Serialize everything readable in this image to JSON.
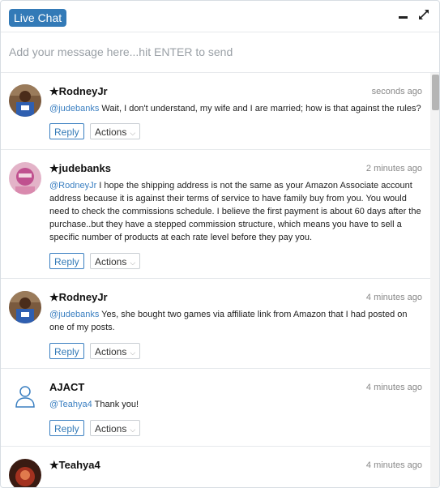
{
  "header": {
    "title": "Live Chat",
    "minimize_icon": "minimize-icon",
    "expand_icon": "expand-icon"
  },
  "composer": {
    "placeholder": "Add your message here...hit ENTER to send"
  },
  "messages": [
    {
      "author": "★RodneyJr",
      "time": "seconds ago",
      "mention": "@judebanks",
      "text": " Wait, I don't understand, my wife and I are married; how is that against the rules?",
      "reply_label": "Reply",
      "actions_label": "Actions",
      "avatar": "photo-avatar"
    },
    {
      "author": "★judebanks",
      "time": "2 minutes ago",
      "mention": "@RodneyJr",
      "text": " I hope the shipping address is not the same as your Amazon Associate account address because it is against their terms of service to have family buy from you. You would need to check the commissions schedule. I believe the first payment is about 60 days after the purchase..but they have a stepped commission structure, which means you have to sell a specific number of products at each rate level before they pay you.",
      "reply_label": "Reply",
      "actions_label": "Actions",
      "avatar": "photo-avatar"
    },
    {
      "author": "★RodneyJr",
      "time": "4 minutes ago",
      "mention": "@judebanks",
      "text": " Yes, she bought two games via affiliate link from Amazon that I had posted on one of my posts.",
      "reply_label": "Reply",
      "actions_label": "Actions",
      "avatar": "photo-avatar"
    },
    {
      "author": "AJACT",
      "time": "4 minutes ago",
      "mention": "@Teahya4",
      "text": " Thank you!",
      "reply_label": "Reply",
      "actions_label": "Actions",
      "avatar": "user-outline-icon"
    },
    {
      "author": "★Teahya4",
      "time": "4 minutes ago",
      "mention": "",
      "text": "",
      "reply_label": "",
      "actions_label": "",
      "avatar": "photo-avatar"
    }
  ],
  "colors": {
    "accent": "#337ab7",
    "mention": "#3a7fc1"
  }
}
